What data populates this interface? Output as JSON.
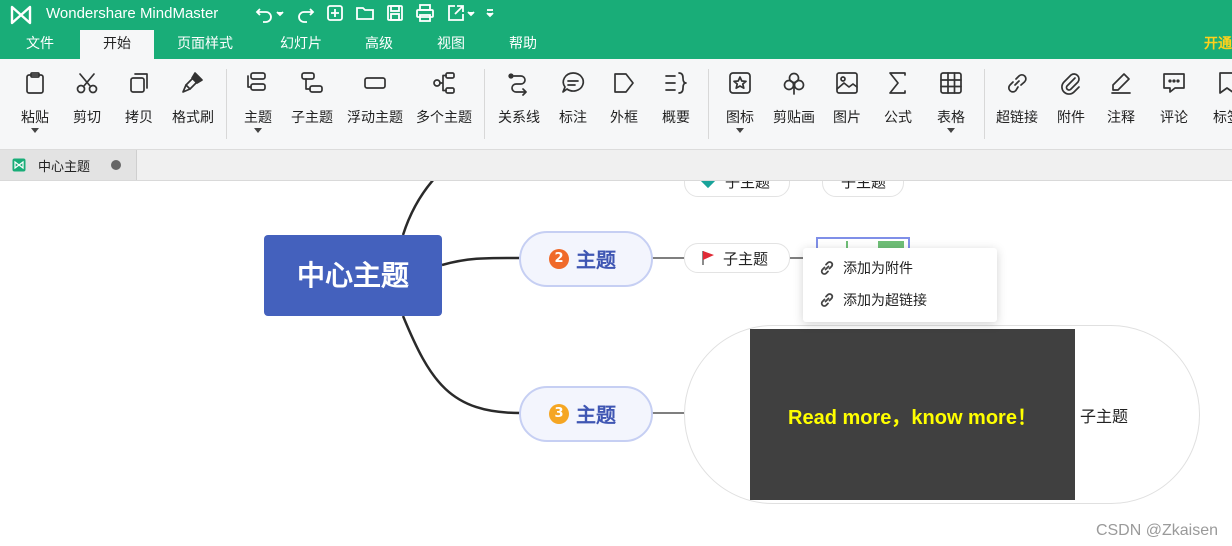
{
  "app": {
    "title": "Wondershare MindMaster"
  },
  "colors": {
    "brand": "#19ad78",
    "central": "#4461bd",
    "topic_border": "#c6cff3",
    "badge2": "#f06a2a",
    "badge3": "#f5a623",
    "image_bg": "#404040",
    "image_text": "#ffff00",
    "highlight": "#ffd11a"
  },
  "quick_access": [
    "undo-icon",
    "redo-icon",
    "new-file-icon",
    "open-folder-icon",
    "save-icon",
    "print-icon",
    "export-icon",
    "customize-icon"
  ],
  "menu": {
    "items": [
      "文件",
      "开始",
      "页面样式",
      "幻灯片",
      "高级",
      "视图",
      "帮助"
    ],
    "active": "开始",
    "right": "开通"
  },
  "ribbon": {
    "paste": "粘贴",
    "cut": "剪切",
    "copy": "拷贝",
    "format_brush": "格式刷",
    "topic": "主题",
    "subtopic": "子主题",
    "floating_topic": "浮动主题",
    "multi_topic": "多个主题",
    "relation": "关系线",
    "callout": "标注",
    "boundary": "外框",
    "summary": "概要",
    "icon": "图标",
    "clipart": "剪贴画",
    "image": "图片",
    "formula": "公式",
    "table": "表格",
    "hyperlink": "超链接",
    "attachment": "附件",
    "note": "注释",
    "comment": "评论",
    "tag": "标签"
  },
  "doc_tab": {
    "title": "中心主题"
  },
  "map": {
    "central": "中心主题",
    "topics": [
      {
        "num": "2",
        "label": "主题"
      },
      {
        "num": "3",
        "label": "主题"
      }
    ],
    "subtopic_top_left": "子主题",
    "subtopic_top_right": "子主题",
    "subtopic_flag": "子主题",
    "subtopic_image": "子主题",
    "image_text": "Read more，know more！"
  },
  "context_menu": {
    "add_attachment": "添加为附件",
    "add_hyperlink": "添加为超链接"
  },
  "watermark": "CSDN @Zkaisen"
}
